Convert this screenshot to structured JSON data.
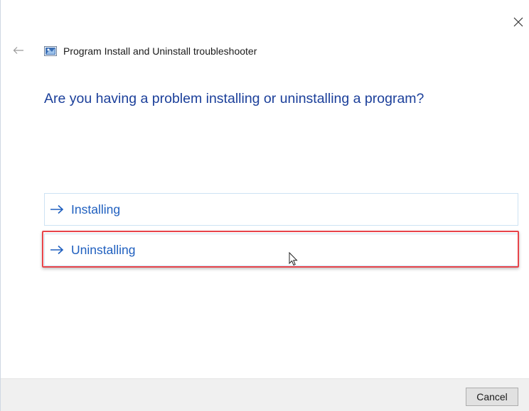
{
  "window": {
    "title": "Program Install and Uninstall troubleshooter"
  },
  "icons": {
    "close": "close-icon",
    "back": "back-arrow-icon",
    "app": "troubleshooter-icon",
    "option_arrow": "right-arrow-icon",
    "cursor": "mouse-pointer-icon"
  },
  "main": {
    "heading": "Are you having a problem installing or uninstalling a program?",
    "options": [
      {
        "label": "Installing"
      },
      {
        "label": "Uninstalling"
      }
    ]
  },
  "footer": {
    "cancel_label": "Cancel"
  },
  "colors": {
    "heading": "#1b3f9a",
    "option_text": "#1f5fbf",
    "option_border": "#cde3f3",
    "highlight": "#e8444a",
    "footer_bg": "#f0f0f0"
  }
}
